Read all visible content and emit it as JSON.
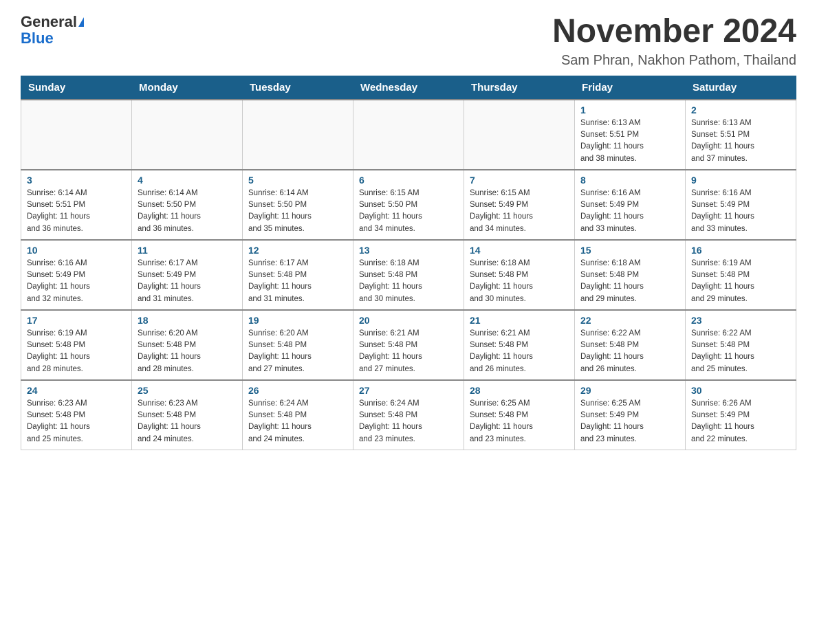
{
  "header": {
    "logo_general": "General",
    "logo_blue": "Blue",
    "month_title": "November 2024",
    "location": "Sam Phran, Nakhon Pathom, Thailand"
  },
  "days_of_week": [
    "Sunday",
    "Monday",
    "Tuesday",
    "Wednesday",
    "Thursday",
    "Friday",
    "Saturday"
  ],
  "weeks": [
    [
      {
        "day": "",
        "info": ""
      },
      {
        "day": "",
        "info": ""
      },
      {
        "day": "",
        "info": ""
      },
      {
        "day": "",
        "info": ""
      },
      {
        "day": "",
        "info": ""
      },
      {
        "day": "1",
        "info": "Sunrise: 6:13 AM\nSunset: 5:51 PM\nDaylight: 11 hours\nand 38 minutes."
      },
      {
        "day": "2",
        "info": "Sunrise: 6:13 AM\nSunset: 5:51 PM\nDaylight: 11 hours\nand 37 minutes."
      }
    ],
    [
      {
        "day": "3",
        "info": "Sunrise: 6:14 AM\nSunset: 5:51 PM\nDaylight: 11 hours\nand 36 minutes."
      },
      {
        "day": "4",
        "info": "Sunrise: 6:14 AM\nSunset: 5:50 PM\nDaylight: 11 hours\nand 36 minutes."
      },
      {
        "day": "5",
        "info": "Sunrise: 6:14 AM\nSunset: 5:50 PM\nDaylight: 11 hours\nand 35 minutes."
      },
      {
        "day": "6",
        "info": "Sunrise: 6:15 AM\nSunset: 5:50 PM\nDaylight: 11 hours\nand 34 minutes."
      },
      {
        "day": "7",
        "info": "Sunrise: 6:15 AM\nSunset: 5:49 PM\nDaylight: 11 hours\nand 34 minutes."
      },
      {
        "day": "8",
        "info": "Sunrise: 6:16 AM\nSunset: 5:49 PM\nDaylight: 11 hours\nand 33 minutes."
      },
      {
        "day": "9",
        "info": "Sunrise: 6:16 AM\nSunset: 5:49 PM\nDaylight: 11 hours\nand 33 minutes."
      }
    ],
    [
      {
        "day": "10",
        "info": "Sunrise: 6:16 AM\nSunset: 5:49 PM\nDaylight: 11 hours\nand 32 minutes."
      },
      {
        "day": "11",
        "info": "Sunrise: 6:17 AM\nSunset: 5:49 PM\nDaylight: 11 hours\nand 31 minutes."
      },
      {
        "day": "12",
        "info": "Sunrise: 6:17 AM\nSunset: 5:48 PM\nDaylight: 11 hours\nand 31 minutes."
      },
      {
        "day": "13",
        "info": "Sunrise: 6:18 AM\nSunset: 5:48 PM\nDaylight: 11 hours\nand 30 minutes."
      },
      {
        "day": "14",
        "info": "Sunrise: 6:18 AM\nSunset: 5:48 PM\nDaylight: 11 hours\nand 30 minutes."
      },
      {
        "day": "15",
        "info": "Sunrise: 6:18 AM\nSunset: 5:48 PM\nDaylight: 11 hours\nand 29 minutes."
      },
      {
        "day": "16",
        "info": "Sunrise: 6:19 AM\nSunset: 5:48 PM\nDaylight: 11 hours\nand 29 minutes."
      }
    ],
    [
      {
        "day": "17",
        "info": "Sunrise: 6:19 AM\nSunset: 5:48 PM\nDaylight: 11 hours\nand 28 minutes."
      },
      {
        "day": "18",
        "info": "Sunrise: 6:20 AM\nSunset: 5:48 PM\nDaylight: 11 hours\nand 28 minutes."
      },
      {
        "day": "19",
        "info": "Sunrise: 6:20 AM\nSunset: 5:48 PM\nDaylight: 11 hours\nand 27 minutes."
      },
      {
        "day": "20",
        "info": "Sunrise: 6:21 AM\nSunset: 5:48 PM\nDaylight: 11 hours\nand 27 minutes."
      },
      {
        "day": "21",
        "info": "Sunrise: 6:21 AM\nSunset: 5:48 PM\nDaylight: 11 hours\nand 26 minutes."
      },
      {
        "day": "22",
        "info": "Sunrise: 6:22 AM\nSunset: 5:48 PM\nDaylight: 11 hours\nand 26 minutes."
      },
      {
        "day": "23",
        "info": "Sunrise: 6:22 AM\nSunset: 5:48 PM\nDaylight: 11 hours\nand 25 minutes."
      }
    ],
    [
      {
        "day": "24",
        "info": "Sunrise: 6:23 AM\nSunset: 5:48 PM\nDaylight: 11 hours\nand 25 minutes."
      },
      {
        "day": "25",
        "info": "Sunrise: 6:23 AM\nSunset: 5:48 PM\nDaylight: 11 hours\nand 24 minutes."
      },
      {
        "day": "26",
        "info": "Sunrise: 6:24 AM\nSunset: 5:48 PM\nDaylight: 11 hours\nand 24 minutes."
      },
      {
        "day": "27",
        "info": "Sunrise: 6:24 AM\nSunset: 5:48 PM\nDaylight: 11 hours\nand 23 minutes."
      },
      {
        "day": "28",
        "info": "Sunrise: 6:25 AM\nSunset: 5:48 PM\nDaylight: 11 hours\nand 23 minutes."
      },
      {
        "day": "29",
        "info": "Sunrise: 6:25 AM\nSunset: 5:49 PM\nDaylight: 11 hours\nand 23 minutes."
      },
      {
        "day": "30",
        "info": "Sunrise: 6:26 AM\nSunset: 5:49 PM\nDaylight: 11 hours\nand 22 minutes."
      }
    ]
  ]
}
